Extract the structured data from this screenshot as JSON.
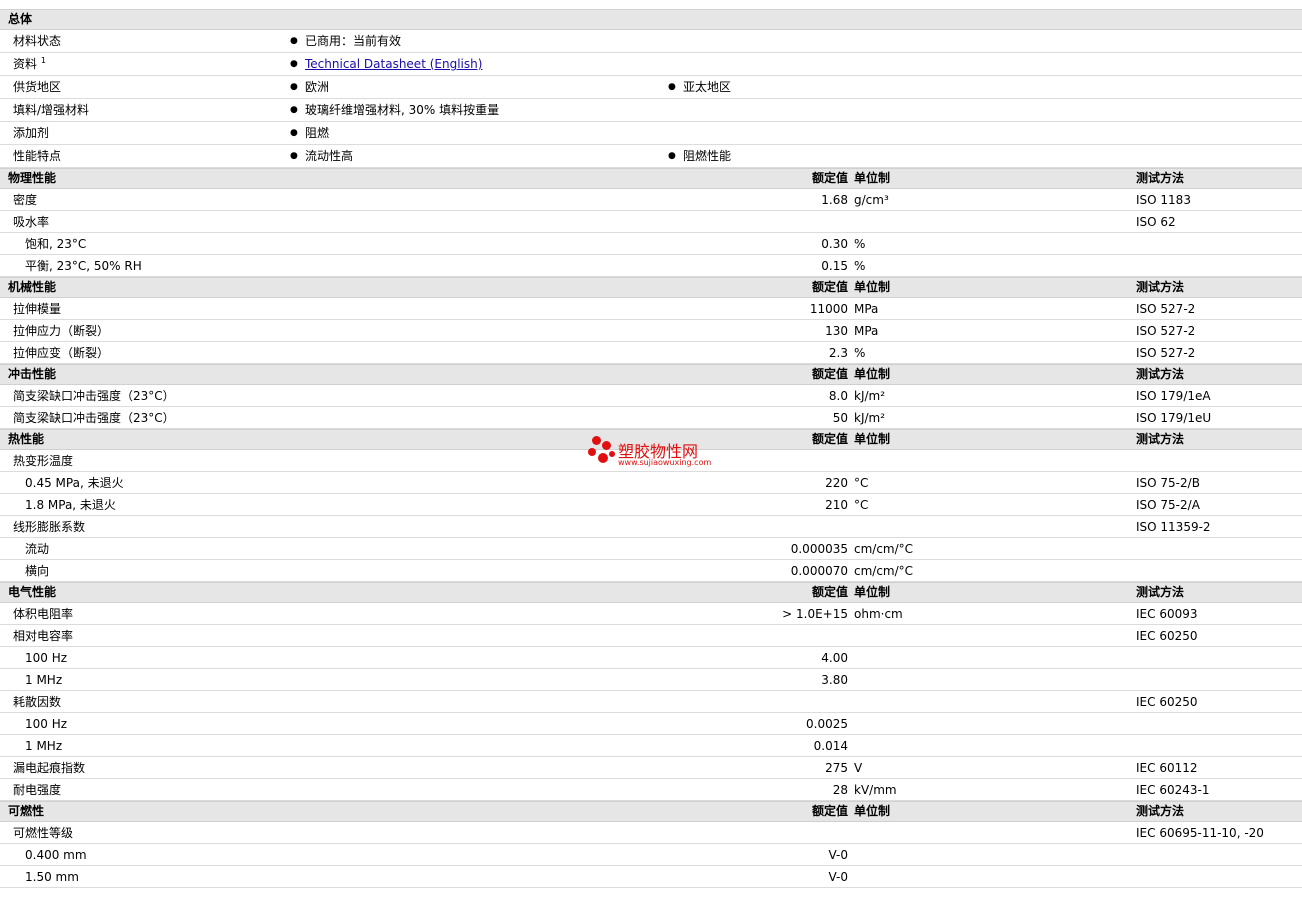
{
  "general": {
    "header": "总体",
    "rows": [
      {
        "label": "材料状态",
        "items": [
          "已商用：当前有效"
        ]
      },
      {
        "label": "资料",
        "sup": "1",
        "link": "Technical Datasheet (English)"
      },
      {
        "label": "供货地区",
        "items": [
          "欧洲",
          "亚太地区"
        ]
      },
      {
        "label": "填料/增强材料",
        "items": [
          "玻璃纤维增强材料, 30% 填料按重量"
        ]
      },
      {
        "label": "添加剂",
        "items": [
          "阻燃"
        ]
      },
      {
        "label": "性能特点",
        "items": [
          "流动性高",
          "阻燃性能"
        ]
      }
    ]
  },
  "columns": {
    "value": "额定值",
    "unit": "单位制",
    "method": "测试方法"
  },
  "sections": [
    {
      "title": "物理性能",
      "rows": [
        {
          "label": "密度",
          "value": "1.68",
          "unit": "g/cm³",
          "method": "ISO 1183"
        },
        {
          "label": "吸水率",
          "value": "",
          "unit": "",
          "method": "ISO 62"
        },
        {
          "label": "饱和, 23°C",
          "sub": true,
          "value": "0.30",
          "unit": "%",
          "method": ""
        },
        {
          "label": "平衡, 23°C, 50% RH",
          "sub": true,
          "value": "0.15",
          "unit": "%",
          "method": ""
        }
      ]
    },
    {
      "title": "机械性能",
      "rows": [
        {
          "label": "拉伸模量",
          "value": "11000",
          "unit": "MPa",
          "method": "ISO 527-2"
        },
        {
          "label": "拉伸应力（断裂）",
          "value": "130",
          "unit": "MPa",
          "method": "ISO 527-2"
        },
        {
          "label": "拉伸应变（断裂）",
          "value": "2.3",
          "unit": "%",
          "method": "ISO 527-2"
        }
      ]
    },
    {
      "title": "冲击性能",
      "rows": [
        {
          "label": "简支梁缺口冲击强度（23°C）",
          "value": "8.0",
          "unit": "kJ/m²",
          "method": "ISO 179/1eA"
        },
        {
          "label": "简支梁缺口冲击强度（23°C）",
          "value": "50",
          "unit": "kJ/m²",
          "method": "ISO 179/1eU"
        }
      ]
    },
    {
      "title": "热性能",
      "rows": [
        {
          "label": "热变形温度",
          "value": "",
          "unit": "",
          "method": ""
        },
        {
          "label": "0.45 MPa, 未退火",
          "sub": true,
          "value": "220",
          "unit": "°C",
          "method": "ISO 75-2/B"
        },
        {
          "label": "1.8 MPa, 未退火",
          "sub": true,
          "value": "210",
          "unit": "°C",
          "method": "ISO 75-2/A"
        },
        {
          "label": "线形膨胀系数",
          "value": "",
          "unit": "",
          "method": "ISO 11359-2"
        },
        {
          "label": "流动",
          "sub": true,
          "value": "0.000035",
          "unit": "cm/cm/°C",
          "method": ""
        },
        {
          "label": "横向",
          "sub": true,
          "value": "0.000070",
          "unit": "cm/cm/°C",
          "method": ""
        }
      ]
    },
    {
      "title": "电气性能",
      "rows": [
        {
          "label": "体积电阻率",
          "value": "> 1.0E+15",
          "unit": "ohm·cm",
          "method": "IEC 60093"
        },
        {
          "label": "相对电容率",
          "value": "",
          "unit": "",
          "method": "IEC 60250"
        },
        {
          "label": "100 Hz",
          "sub": true,
          "value": "4.00",
          "unit": "",
          "method": ""
        },
        {
          "label": "1 MHz",
          "sub": true,
          "value": "3.80",
          "unit": "",
          "method": ""
        },
        {
          "label": "耗散因数",
          "value": "",
          "unit": "",
          "method": "IEC 60250"
        },
        {
          "label": "100 Hz",
          "sub": true,
          "value": "0.0025",
          "unit": "",
          "method": ""
        },
        {
          "label": "1 MHz",
          "sub": true,
          "value": "0.014",
          "unit": "",
          "method": ""
        },
        {
          "label": "漏电起痕指数",
          "value": "275",
          "unit": "V",
          "method": "IEC 60112"
        },
        {
          "label": "耐电强度",
          "value": "28",
          "unit": "kV/mm",
          "method": "IEC 60243-1"
        }
      ]
    },
    {
      "title": "可燃性",
      "rows": [
        {
          "label": "可燃性等级",
          "value": "",
          "unit": "",
          "method": "IEC 60695-11-10, -20"
        },
        {
          "label": "0.400 mm",
          "sub": true,
          "value": "V-0",
          "unit": "",
          "method": ""
        },
        {
          "label": "1.50 mm",
          "sub": true,
          "value": "V-0",
          "unit": "",
          "method": ""
        }
      ]
    }
  ],
  "watermark": {
    "title": "塑胶物性网",
    "url": "www.sujiaowuxing.com",
    "color": "#e01010"
  }
}
